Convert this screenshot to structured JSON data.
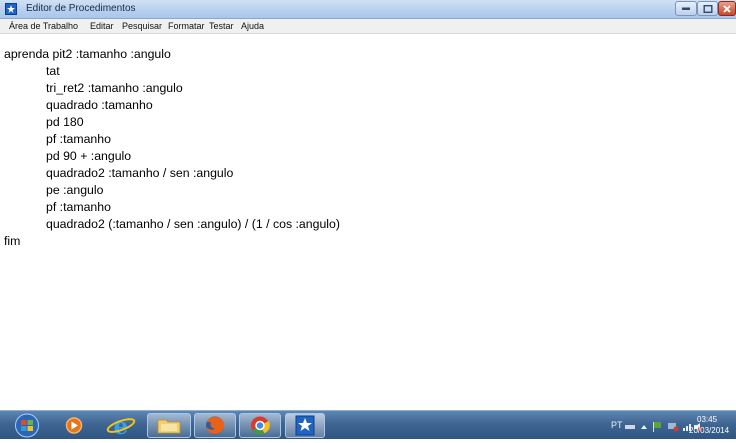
{
  "window": {
    "title": "Editor de Procedimentos"
  },
  "menu": [
    {
      "label": "Área de Trabalho"
    },
    {
      "label": "Editar"
    },
    {
      "label": "Pesquisar"
    },
    {
      "label": "Formatar"
    },
    {
      "label": "Testar"
    },
    {
      "label": "Ajuda"
    }
  ],
  "editor": {
    "lines": [
      {
        "text": "aprenda pit2 :tamanho :angulo",
        "indent": false
      },
      {
        "text": "tat",
        "indent": true
      },
      {
        "text": "tri_ret2 :tamanho :angulo",
        "indent": true
      },
      {
        "text": "quadrado :tamanho",
        "indent": true
      },
      {
        "text": "pd 180",
        "indent": true
      },
      {
        "text": "pf :tamanho",
        "indent": true
      },
      {
        "text": "pd 90 + :angulo",
        "indent": true
      },
      {
        "text": "quadrado2 :tamanho / sen :angulo",
        "indent": true
      },
      {
        "text": "pe :angulo",
        "indent": true
      },
      {
        "text": "pf :tamanho",
        "indent": true
      },
      {
        "text": "quadrado2 (:tamanho / sen :angulo) / (1 / cos :angulo)",
        "indent": true
      },
      {
        "text": "fim",
        "indent": false
      }
    ]
  },
  "taskbar": {
    "apps": [
      {
        "name": "start-button"
      },
      {
        "name": "media-player"
      },
      {
        "name": "internet-explorer"
      },
      {
        "name": "file-explorer"
      },
      {
        "name": "firefox"
      },
      {
        "name": "chrome"
      },
      {
        "name": "logo-editor",
        "active": true
      }
    ],
    "language": "PT",
    "time": "03:45",
    "date": "20/03/2014"
  },
  "colors": {
    "titlebar": "#b6cfee",
    "taskbar": "#3f6693",
    "editor_background": "#ffffff",
    "text": "#000000"
  }
}
